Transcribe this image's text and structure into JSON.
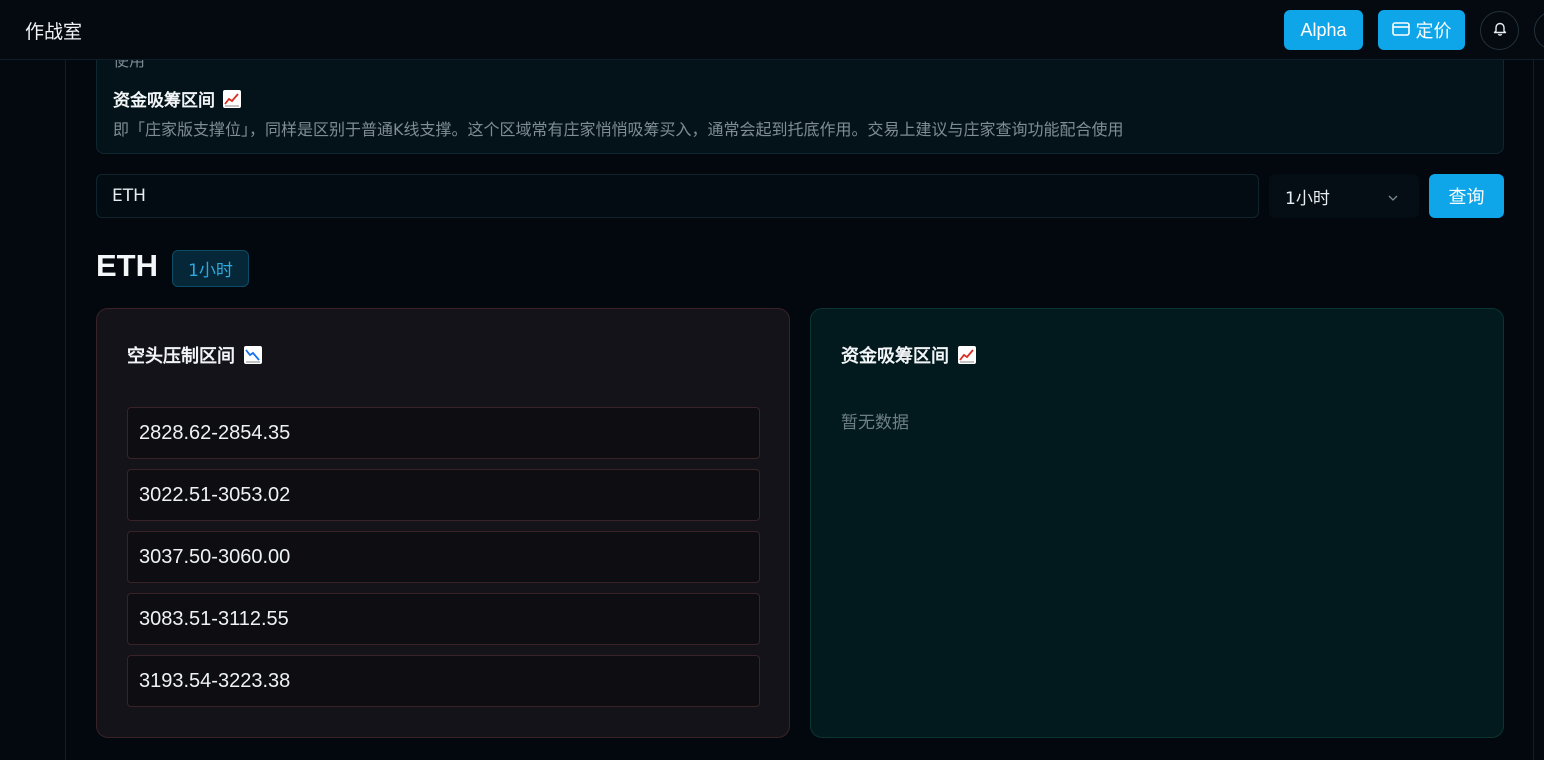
{
  "app": {
    "title": "作战室"
  },
  "header": {
    "alpha_label": "Alpha",
    "pricing_label": "定价",
    "accent_color": "#0ea5e9"
  },
  "info": {
    "prev_tail": "使用",
    "heading": "资金吸筹区间",
    "description": "即「庄家版支撑位」，同样是区别于普通K线支撑。这个区域常有庄家悄悄吸筹买入，通常会起到托底作用。交易上建议与庄家查询功能配合使用"
  },
  "search": {
    "symbol_value": "ETH",
    "timeframe_selected": "1小时",
    "query_label": "查询"
  },
  "result": {
    "symbol": "ETH",
    "timeframe_badge": "1小时",
    "bear_panel": {
      "title": "空头压制区间",
      "icon": "chart-decreasing-icon",
      "zones": [
        "2828.62-2854.35",
        "3022.51-3053.02",
        "3037.50-3060.00",
        "3083.51-3112.55",
        "3193.54-3223.38"
      ]
    },
    "bull_panel": {
      "title": "资金吸筹区间",
      "icon": "chart-increasing-icon",
      "empty_text": "暂无数据"
    }
  }
}
